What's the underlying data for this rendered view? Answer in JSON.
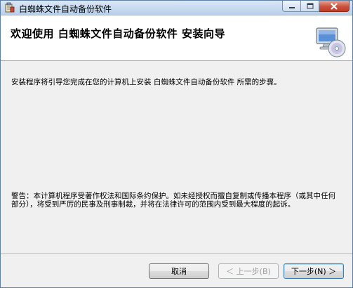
{
  "window": {
    "title": "白蜘蛛文件自动备份软件",
    "controls": {
      "minimize": "minimize-icon",
      "maximize": "maximize-icon",
      "close": "close-icon"
    }
  },
  "header": {
    "title": "欢迎使用 白蜘蛛文件自动备份软件 安装向导",
    "icon": "computer-cd-icon"
  },
  "body": {
    "intro": "安装程序将引导您完成在您的计算机上安装 白蜘蛛文件自动备份软件 所需的步骤。",
    "warning": "警告：本计算机程序受著作权法和国际条约保护。如未经授权而擅自复制或传播本程序（或其中任何部分），将受到严厉的民事及刑事制裁，并将在法律许可的范围内受到最大程度的起诉。"
  },
  "buttons": {
    "cancel": "取消",
    "back": "＜ 上一步(B)",
    "next": "下一步(N) ＞"
  },
  "colors": {
    "close_button": "#c9533f",
    "titlebar": "#c7daf0",
    "default_button_border": "#3c7fb1"
  }
}
